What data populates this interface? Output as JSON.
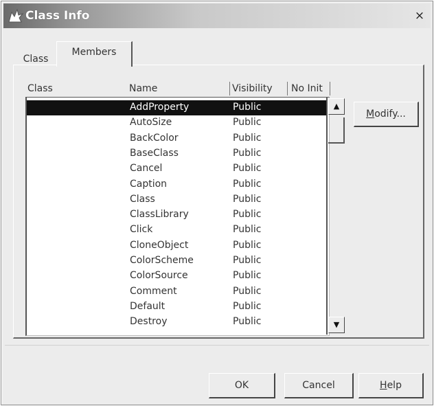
{
  "window": {
    "title": "Class Info",
    "close_label": "×"
  },
  "tabs": [
    {
      "label": "Class",
      "active": false
    },
    {
      "label": "Members",
      "active": true
    }
  ],
  "list": {
    "columns": [
      "Class",
      "Name",
      "Visibility",
      "No Init"
    ],
    "rows": [
      {
        "class": "",
        "name": "AddProperty",
        "visibility": "Public",
        "no_init": "",
        "selected": true
      },
      {
        "class": "",
        "name": "AutoSize",
        "visibility": "Public",
        "no_init": ""
      },
      {
        "class": "",
        "name": "BackColor",
        "visibility": "Public",
        "no_init": ""
      },
      {
        "class": "",
        "name": "BaseClass",
        "visibility": "Public",
        "no_init": ""
      },
      {
        "class": "",
        "name": "Cancel",
        "visibility": "Public",
        "no_init": ""
      },
      {
        "class": "",
        "name": "Caption",
        "visibility": "Public",
        "no_init": ""
      },
      {
        "class": "",
        "name": "Class",
        "visibility": "Public",
        "no_init": ""
      },
      {
        "class": "",
        "name": "ClassLibrary",
        "visibility": "Public",
        "no_init": ""
      },
      {
        "class": "",
        "name": "Click",
        "visibility": "Public",
        "no_init": ""
      },
      {
        "class": "",
        "name": "CloneObject",
        "visibility": "Public",
        "no_init": ""
      },
      {
        "class": "",
        "name": "ColorScheme",
        "visibility": "Public",
        "no_init": ""
      },
      {
        "class": "",
        "name": "ColorSource",
        "visibility": "Public",
        "no_init": ""
      },
      {
        "class": "",
        "name": "Comment",
        "visibility": "Public",
        "no_init": ""
      },
      {
        "class": "",
        "name": "Default",
        "visibility": "Public",
        "no_init": ""
      },
      {
        "class": "",
        "name": "Destroy",
        "visibility": "Public",
        "no_init": ""
      }
    ]
  },
  "buttons": {
    "modify": {
      "before": "",
      "mnemonic": "M",
      "after": "odify..."
    },
    "ok": {
      "label": "OK"
    },
    "cancel": {
      "label": "Cancel"
    },
    "help": {
      "before": "",
      "mnemonic": "H",
      "after": "elp"
    }
  },
  "scrollbar": {
    "up_glyph": "▲",
    "down_glyph": "▼"
  },
  "icons": {
    "title": "fox-icon"
  }
}
